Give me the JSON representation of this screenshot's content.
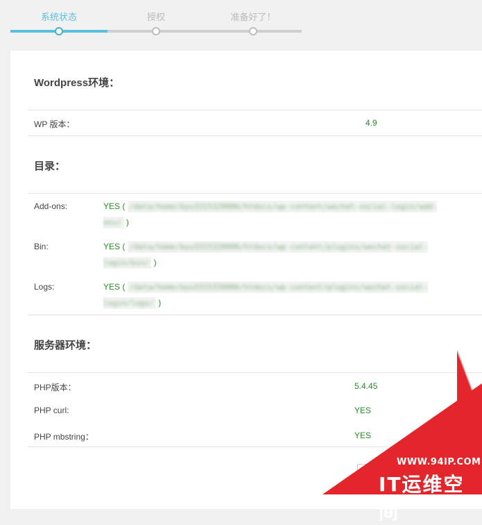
{
  "steps": [
    {
      "label": "系统状态",
      "active": true
    },
    {
      "label": "授权",
      "active": false
    },
    {
      "label": "准备好了！",
      "active": false
    }
  ],
  "wordpress": {
    "title": "Wordpress环境：",
    "wp_version_label": "WP 版本：",
    "wp_version_value": "4.9"
  },
  "dirs": {
    "title": "目录：",
    "items": [
      {
        "label": "Add-ons:",
        "status": "YES",
        "path_visible": "/data/home/byu3315320006/htdocs/wp-content/wechat-social-login/add-ons/"
      },
      {
        "label": "Bin:",
        "status": "YES",
        "path_visible": "/data/home/byu3315320006/htdocs/wp-content/plugins/wechat-social-login/bin/"
      },
      {
        "label": "Logs:",
        "status": "YES",
        "path_visible": "/data/home/byu3315320006/htdocs/wp-content/plugins/wechat-social-login/logs/"
      }
    ]
  },
  "server": {
    "title": "服务器环境：",
    "rows": [
      {
        "label": "PHP版本：",
        "value": "5.4.45"
      },
      {
        "label": "PHP curl:",
        "value": "YES"
      },
      {
        "label": "PHP mbstring：",
        "value": "YES"
      }
    ]
  },
  "watermark": {
    "url": "WWW.94IP.COM",
    "name": "IT运维空间"
  },
  "colors": {
    "accent": "#5bc0de",
    "ok": "#2a8c2a",
    "watermark": "#e3262b"
  }
}
